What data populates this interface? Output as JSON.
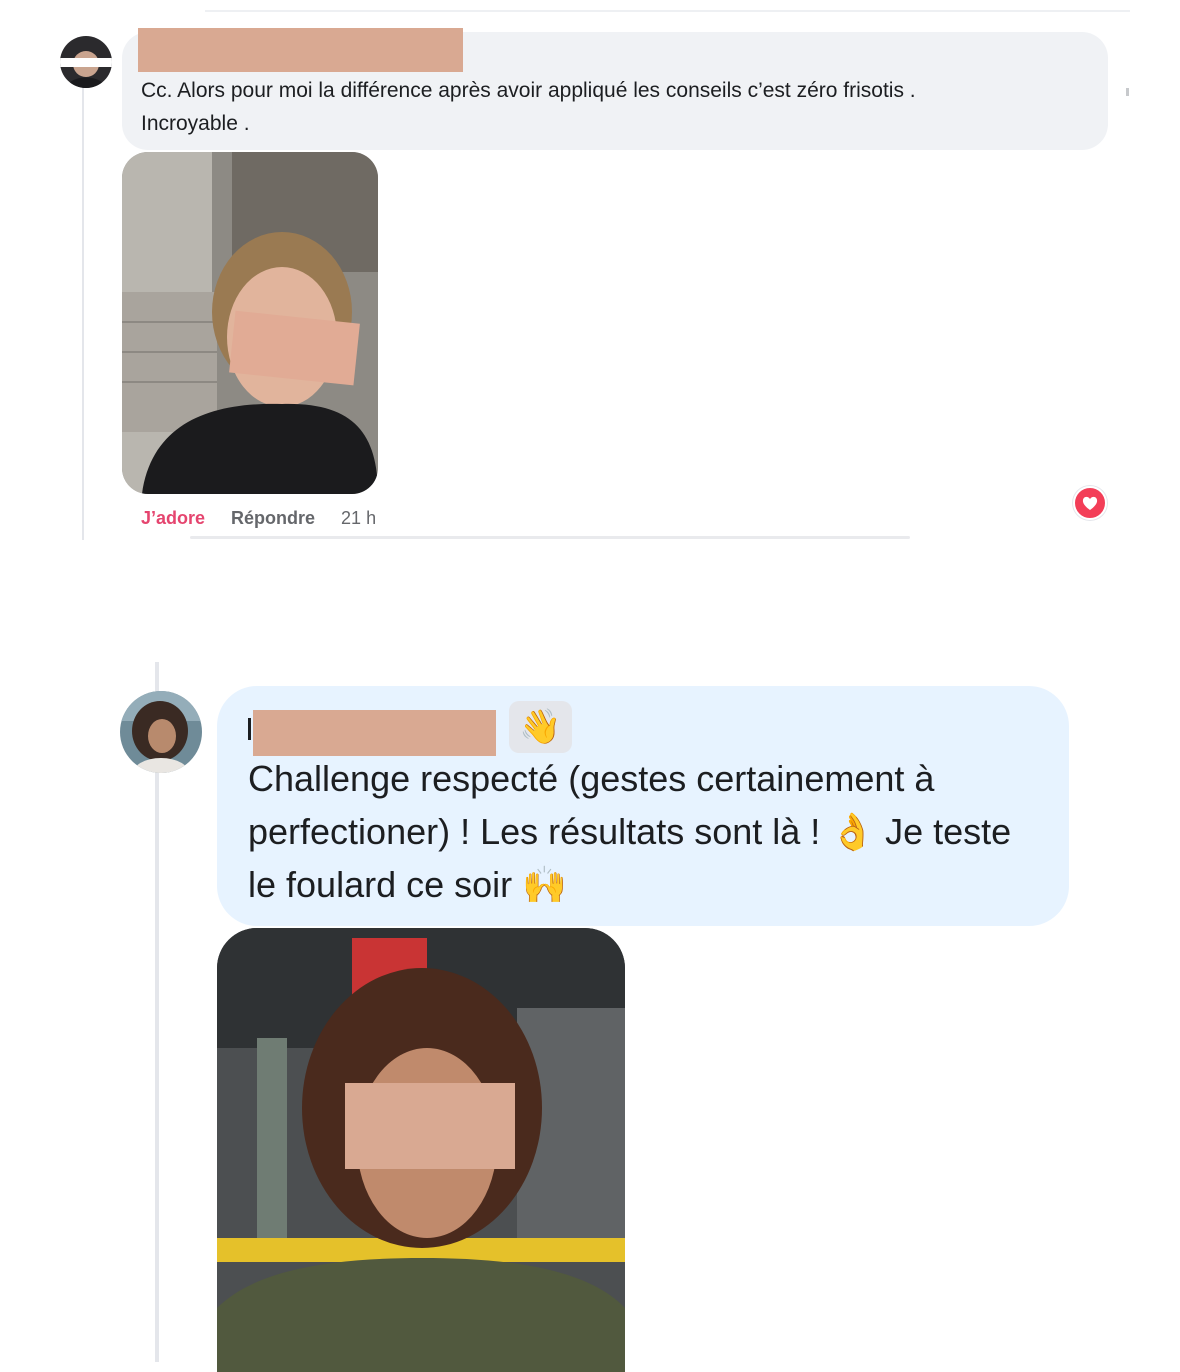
{
  "comment1": {
    "text": "Cc. Alors pour moi la différence après avoir appliqué les conseils c’est zéro frisotis .\nIncroyable .",
    "actions": {
      "like": "J’adore",
      "reply": "Répondre",
      "time": "21 h"
    },
    "reaction_icon": "heart-icon"
  },
  "comment2": {
    "badge_icon": "waving-hand-icon",
    "badge_emoji": "👋",
    "text_part1": "Challenge respecté (gestes certainement à perfectioner) ! Les résultats sont là ! ",
    "emoji_ok": "👌",
    "text_part2": " Je teste le foulard ce soir ",
    "emoji_hands": "🙌"
  },
  "colors": {
    "bubble_gray": "#f0f2f5",
    "bubble_blue": "#e7f3ff",
    "like_pink": "#e5456f",
    "redaction": "#d9a992"
  }
}
